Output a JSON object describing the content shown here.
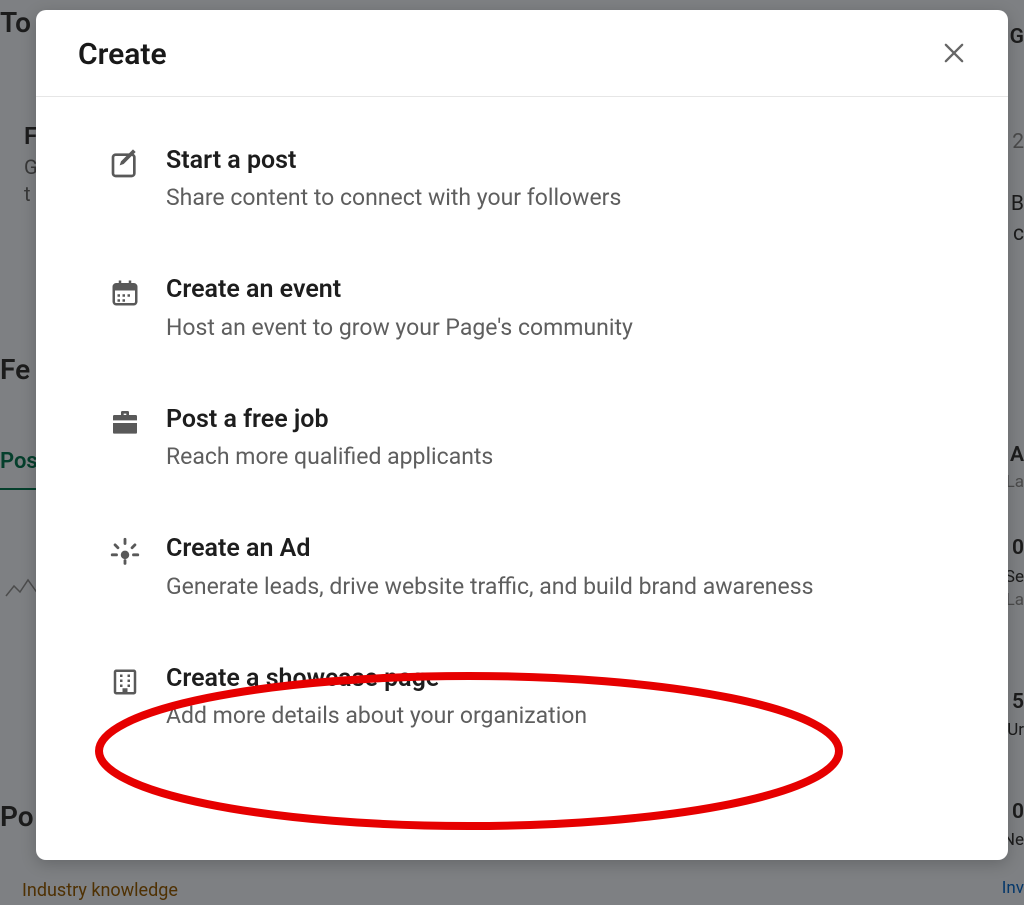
{
  "background": {
    "top_left": "To",
    "f": "F",
    "g": "G",
    "t": "t",
    "fe": "Fe",
    "pos": "Pos",
    "po": "Po",
    "industry": "Industry knowledge",
    "g_right": "G",
    "time_2": "2",
    "b": "B",
    "c": "c",
    "a_right": "A",
    "la": "La",
    "zero": "0",
    "se": "Se",
    "la2": "La",
    "five": "5",
    "ur": "Ur",
    "zero2": "0",
    "ne": "Ne",
    "inv": "Inv"
  },
  "modal": {
    "title": "Create",
    "options": [
      {
        "title": "Start a post",
        "desc": "Share content to connect with your followers",
        "icon": "compose"
      },
      {
        "title": "Create an event",
        "desc": "Host an event to grow your Page's community",
        "icon": "calendar"
      },
      {
        "title": "Post a free job",
        "desc": "Reach more qualified applicants",
        "icon": "briefcase"
      },
      {
        "title": "Create an Ad",
        "desc": "Generate leads, drive website traffic, and build brand awareness",
        "icon": "lightbulb"
      },
      {
        "title": "Create a showcase page",
        "desc": "Add more details about your organization",
        "icon": "building"
      }
    ]
  }
}
